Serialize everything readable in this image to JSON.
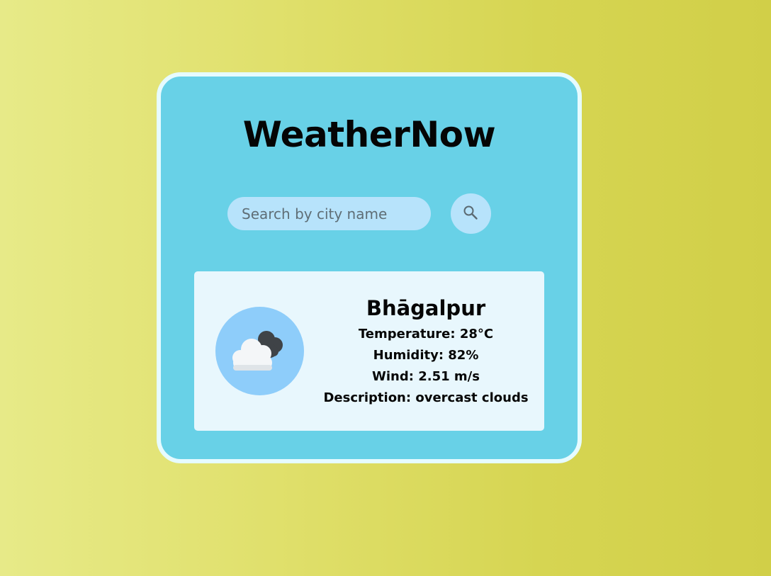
{
  "app": {
    "title": "WeatherNow"
  },
  "search": {
    "placeholder": "Search by city name",
    "button_icon": "search-icon"
  },
  "weather": {
    "city": "Bhāgalpur",
    "icon": "overcast-clouds-icon",
    "temperature": "Temperature: 28°C",
    "humidity": "Humidity: 82%",
    "wind": "Wind: 2.51 m/s",
    "description": "Description: overcast clouds"
  },
  "colors": {
    "background_start": "#e7ea88",
    "background_end": "#d1cf48",
    "card": "#68d1e7",
    "card_border": "#e6fbff",
    "input": "#b7e3fb",
    "panel": "#e8f7fd",
    "icon_circle": "#8ecdfa"
  }
}
